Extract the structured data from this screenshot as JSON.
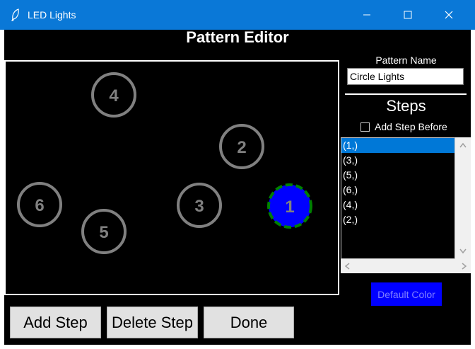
{
  "window": {
    "title": "LED Lights",
    "icon": "feather-icon"
  },
  "window_controls": {
    "minimize": "minimize-icon",
    "maximize": "maximize-icon",
    "close": "close-icon"
  },
  "editor": {
    "heading": "Pattern Editor"
  },
  "canvas": {
    "lights": [
      {
        "label": "1",
        "active": true
      },
      {
        "label": "2",
        "active": false
      },
      {
        "label": "3",
        "active": false
      },
      {
        "label": "4",
        "active": false
      },
      {
        "label": "5",
        "active": false
      },
      {
        "label": "6",
        "active": false
      }
    ]
  },
  "side_panel": {
    "pattern_name_label": "Pattern Name",
    "pattern_name_value": "Circle Lights",
    "steps_heading": "Steps",
    "add_step_before_label": "Add Step Before",
    "add_step_before_checked": false,
    "steps": [
      "(1,)",
      "(3,)",
      "(5,)",
      "(6,)",
      "(4,)",
      "(2,)"
    ],
    "selected_step": "(1,)",
    "default_color_label": "Default Color"
  },
  "buttons": {
    "add_step": "Add Step",
    "delete_step": "Delete Step",
    "done": "Done"
  },
  "colors": {
    "title_bar": "#0a78d7",
    "active_light": "#0000ff",
    "active_ring": "#008000",
    "inactive_ring": "#808080",
    "selection": "#0078d7"
  }
}
